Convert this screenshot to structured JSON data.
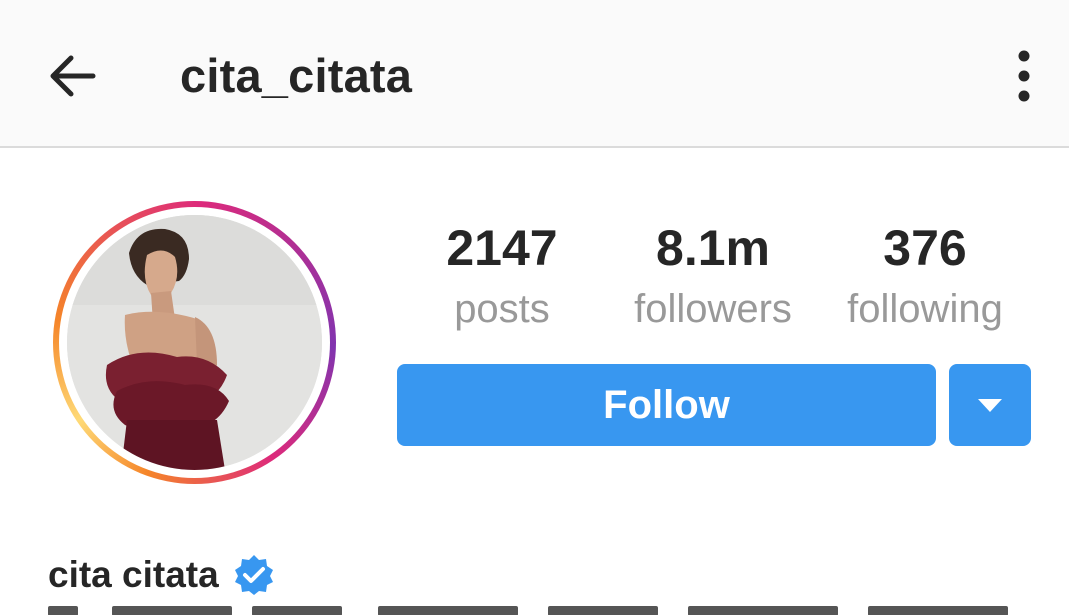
{
  "header": {
    "back_icon": "arrow-left-icon",
    "title": "cita_citata",
    "more_icon": "more-vertical-icon"
  },
  "profile": {
    "avatar_icon": "profile-photo",
    "ring_colors": [
      "#f58529",
      "#dd2a7b",
      "#8134af"
    ],
    "stats": {
      "posts": {
        "value": "2147",
        "label": "posts"
      },
      "followers": {
        "value": "8.1m",
        "label": "followers"
      },
      "following": {
        "value": "376",
        "label": "following"
      }
    },
    "follow_label": "Follow",
    "dropdown_icon": "caret-down-icon",
    "accent_color": "#3897f0",
    "full_name": "cita citata",
    "verified_icon": "verified-badge-icon",
    "verified_color": "#3897f0"
  }
}
